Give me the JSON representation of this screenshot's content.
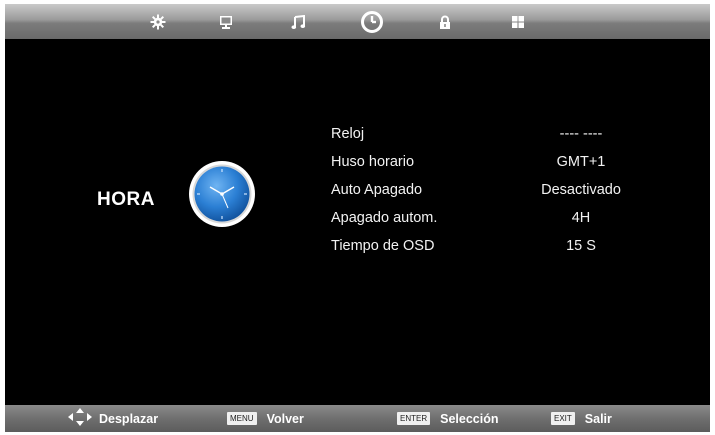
{
  "tabs": [
    {
      "icon": "picture-gear-icon"
    },
    {
      "icon": "monitor-icon"
    },
    {
      "icon": "music-note-icon"
    },
    {
      "icon": "clock-icon",
      "active": true
    },
    {
      "icon": "lock-icon"
    },
    {
      "icon": "windows-grid-icon"
    }
  ],
  "page": {
    "title": "HORA",
    "icon": "analog-clock-icon"
  },
  "settings": [
    {
      "label": "Reloj",
      "value": "---- ----"
    },
    {
      "label": "Huso horario",
      "value": "GMT+1"
    },
    {
      "label": "Auto Apagado",
      "value": "Desactivado"
    },
    {
      "label": "Apagado autom.",
      "value": "4H"
    },
    {
      "label": "Tiempo de OSD",
      "value": "15 S"
    }
  ],
  "footer": {
    "move": {
      "label": "Desplazar",
      "icon": "dpad-arrows-icon"
    },
    "back": {
      "key": "MENU",
      "label": "Volver"
    },
    "select": {
      "key": "ENTER",
      "label": "Selección"
    },
    "exit": {
      "key": "EXIT",
      "label": "Salir"
    }
  },
  "colors": {
    "accent_blue": "#2b7fd4",
    "screen": "#000000",
    "bar": "#8c8c8c"
  }
}
